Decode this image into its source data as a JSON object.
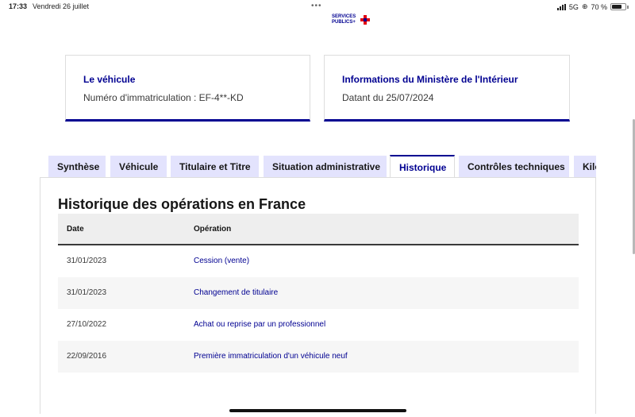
{
  "status_bar": {
    "time": "17:33",
    "date": "Vendredi 26 juillet",
    "network": "5G",
    "battery": "70 %"
  },
  "logo": {
    "line1": "SERVICES",
    "line2": "PUBLICS+"
  },
  "cards": [
    {
      "title": "Le véhicule",
      "text": "Numéro d'immatriculation : EF-4**-KD"
    },
    {
      "title": "Informations du Ministère de l'Intérieur",
      "text": "Datant du 25/07/2024"
    }
  ],
  "tabs": [
    {
      "label": "Synthèse",
      "active": false
    },
    {
      "label": "Véhicule",
      "active": false
    },
    {
      "label": "Titulaire et Titre",
      "active": false
    },
    {
      "label": "Situation administrative",
      "active": false
    },
    {
      "label": "Historique",
      "active": true
    },
    {
      "label": "Contrôles techniques",
      "active": false
    },
    {
      "label": "Kilométrage",
      "active": false
    }
  ],
  "history": {
    "title": "Historique des opérations en France",
    "columns": {
      "date": "Date",
      "operation": "Opération"
    },
    "rows": [
      {
        "date": "31/01/2023",
        "operation": "Cession (vente)"
      },
      {
        "date": "31/01/2023",
        "operation": "Changement de titulaire"
      },
      {
        "date": "27/10/2022",
        "operation": "Achat ou reprise par un professionnel"
      },
      {
        "date": "22/09/2016",
        "operation": "Première immatriculation d'un véhicule neuf"
      }
    ]
  },
  "colors": {
    "accent": "#000091",
    "tab_background": "#e3e3fd",
    "header_background": "#eeeeee",
    "logo_red": "#e1000f"
  }
}
